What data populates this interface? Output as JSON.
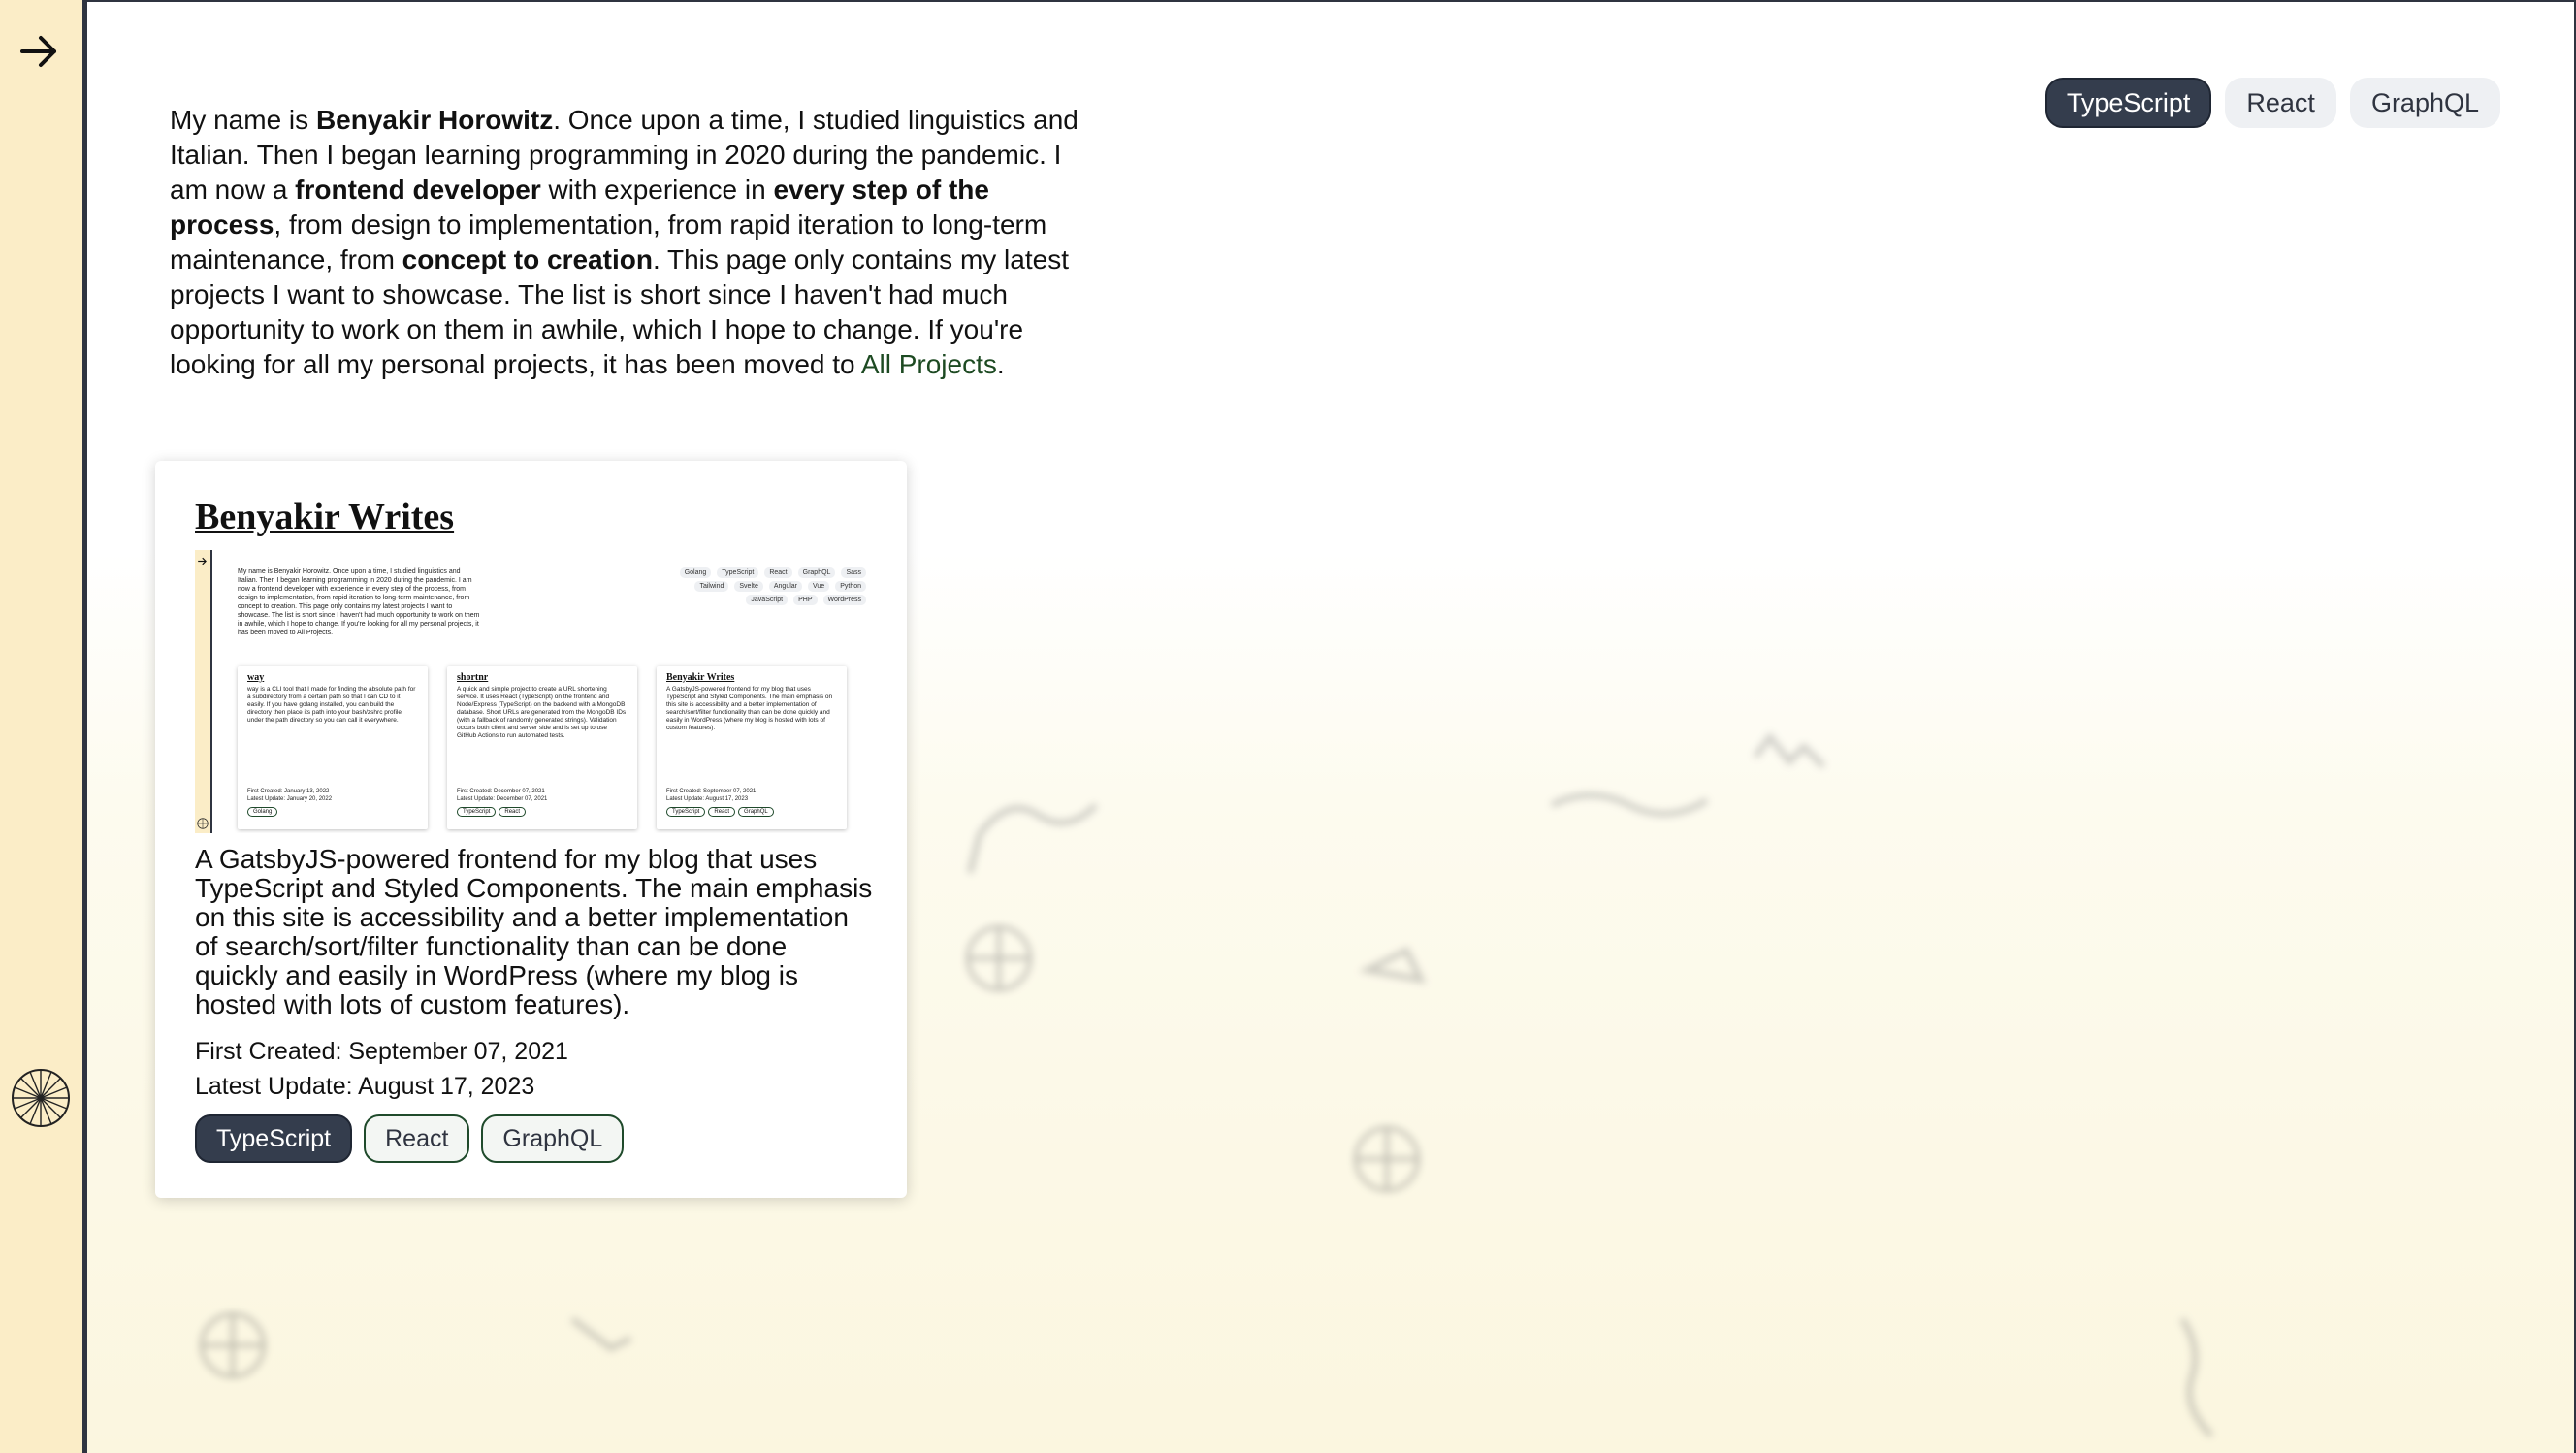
{
  "bio": {
    "p1": "My name is ",
    "name": "Benyakir Horowitz",
    "p2": ". Once upon a time, I studied linguistics and Italian. Then I began learning programming in 2020 during the pandemic. I am now a ",
    "role": "frontend developer",
    "p3": " with experience in ",
    "scope": "every step of the process",
    "p4": ", from design to implementation, from rapid iteration to long-term maintenance, from ",
    "concept": "concept to creation",
    "p5": ". This page only contains my latest projects I want to showcase. The list is short since I haven't had much opportunity to work on them in awhile, which I hope to change. If you're looking for all my personal projects, it has been moved to ",
    "link": "All Projects",
    "p6": "."
  },
  "filters": [
    "TypeScript",
    "React",
    "GraphQL"
  ],
  "card": {
    "title": "Benyakir Writes",
    "description": "A GatsbyJS-powered frontend for my blog that uses TypeScript and Styled Components. The main emphasis on this site is accessibility and a better implementation of search/sort/filter functionality than can be done quickly and easily in WordPress (where my blog is hosted with lots of custom features).",
    "created": "First Created: September 07, 2021",
    "updated": "Latest Update: August 17, 2023",
    "tags": [
      "TypeScript",
      "React",
      "GraphQL"
    ]
  },
  "thumbnail": {
    "bio_text": "My name is Benyakir Horowitz. Once upon a time, I studied linguistics and Italian. Then I began learning programming in 2020 during the pandemic. I am now a frontend developer with experience in every step of the process, from design to implementation, from rapid iteration to long-term maintenance, from concept to creation. This page only contains my latest projects I want to showcase. The list is short since I haven't had much opportunity to work on them in awhile, which I hope to change. If you're looking for all my personal projects, it has been moved to All Projects.",
    "chips": [
      "Golang",
      "TypeScript",
      "React",
      "GraphQL",
      "Sass",
      "Tailwind",
      "Svelte",
      "Angular",
      "Vue",
      "Python",
      "JavaScript",
      "PHP",
      "WordPress"
    ],
    "cards": [
      {
        "title": "way",
        "desc": "way is a CLI tool that I made for finding the absolute path for a subdirectory from a certain path so that I can CD to it easily. If you have golang installed, you can build the directory then place its path into your bash/zshrc profile under the path directory so you can call it everywhere.",
        "created": "First Created: January 13, 2022",
        "updated": "Latest Update: January 20, 2022",
        "tags": [
          "Golang"
        ]
      },
      {
        "title": "shortnr",
        "desc": "A quick and simple project to create a URL shortening service. It uses React (TypeScript) on the frontend and Node/Express (TypeScript) on the backend with a MongoDB database. Short URLs are generated from the MongoDB IDs (with a fallback of randomly generated strings). Validation occurs both client and server side and is set up to use GitHub Actions to run automated tests.",
        "created": "First Created: December 07, 2021",
        "updated": "Latest Update: December 07, 2021",
        "tags": [
          "TypeScript",
          "React"
        ]
      },
      {
        "title": "Benyakir Writes",
        "desc": "A GatsbyJS-powered frontend for my blog that uses TypeScript and Styled Components. The main emphasis on this site is accessibility and a better implementation of search/sort/filter functionality than can be done quickly and easily in WordPress (where my blog is hosted with lots of custom features).",
        "created": "First Created: September 07, 2021",
        "updated": "Latest Update: August 17, 2023",
        "tags": [
          "TypeScript",
          "React",
          "GraphQL"
        ]
      }
    ]
  },
  "icons": {
    "sidebar_toggle": "arrow-right-icon",
    "sidebar_decoration": "wheel-icon"
  },
  "colors": {
    "sidebar_bg": "#fbedc7",
    "dark": "#343d4d",
    "link": "#1d4a22"
  }
}
